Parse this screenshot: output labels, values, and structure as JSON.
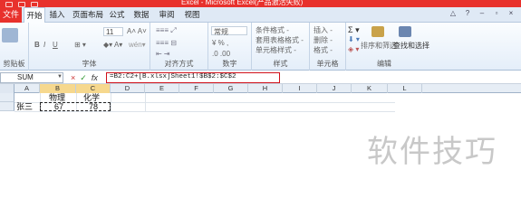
{
  "window": {
    "title": "Excel - Microsoft Excel(产品激活失败)"
  },
  "tabs": [
    {
      "label": "文件"
    },
    {
      "label": "开始"
    },
    {
      "label": "插入"
    },
    {
      "label": "页面布局"
    },
    {
      "label": "公式"
    },
    {
      "label": "数据"
    },
    {
      "label": "审阅"
    },
    {
      "label": "视图"
    }
  ],
  "ribbon": {
    "groups": {
      "clipboard": "剪贴板",
      "font": "字体",
      "alignment": "对齐方式",
      "number": "数字",
      "styles": "样式",
      "cells": "单元格",
      "editing": "编辑"
    },
    "font_size": "11",
    "number_format": "常规",
    "styles_items": [
      "条件格式 -",
      "套用表格格式 -",
      "单元格样式 -"
    ],
    "cells_items": [
      "插入 -",
      "删除 -",
      "格式 -"
    ],
    "sort_filter": "排序和筛选",
    "find_select": "查找和选择",
    "bold": "B",
    "italic": "I",
    "underline": "U"
  },
  "formula_bar": {
    "name_box": "SUM",
    "cancel": "×",
    "enter": "✓",
    "fx": "fx",
    "formula": "=B2:C2+[B.xlsx]Sheet1!$B$2:$C$2"
  },
  "columns": [
    "A",
    "B",
    "C",
    "D",
    "E",
    "F",
    "G",
    "H",
    "I",
    "J",
    "K",
    "L"
  ],
  "rows": [
    "1",
    "2"
  ],
  "cells": {
    "B1": "物理",
    "C1": "化学",
    "A2": "张三",
    "B2": "67",
    "C2": "78"
  },
  "watermark": "软件技巧",
  "colors": {
    "title_bar": "#e8312c",
    "formula_highlight": "#d0101a",
    "selected_column": "#f6d88e"
  }
}
